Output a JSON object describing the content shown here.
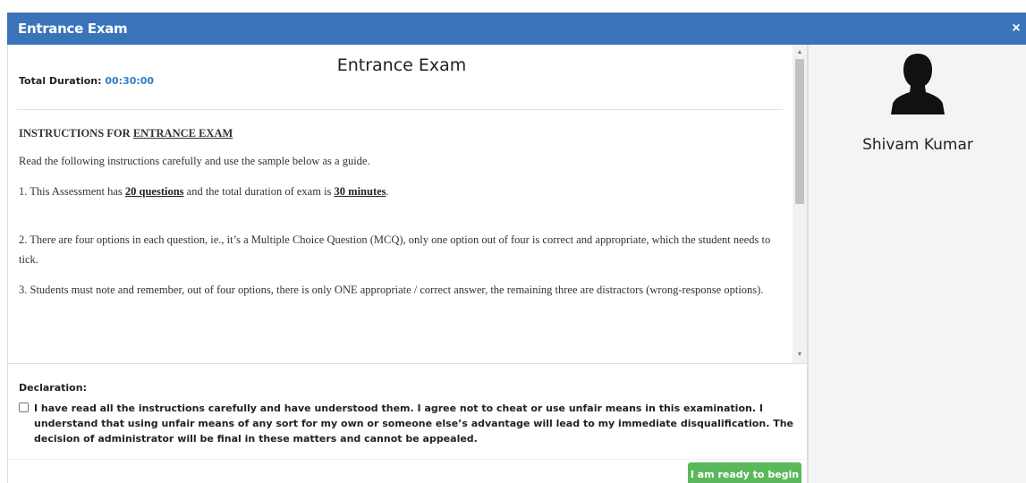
{
  "window": {
    "title": "Entrance Exam",
    "close_glyph": "×",
    "close_icon": "close-icon"
  },
  "exam": {
    "heading": "Entrance Exam",
    "duration_label": "Total Duration:",
    "duration_value": "00:30:00"
  },
  "instructions": {
    "heading_prefix": "INSTRUCTIONS FOR ",
    "heading_underlined": "ENTRANCE EXAM",
    "intro": "Read the following instructions carefully and use the sample below as a guide.",
    "item1": {
      "part1": "1. This Assessment has ",
      "questions": "20 questions",
      "part2": " and the total duration of exam is ",
      "minutes": "30 minutes",
      "part3": "."
    },
    "item2": "2. There are four options in each question, ie., it’s a Multiple Choice Question (MCQ), only one option out of four is correct and appropriate, which the student needs to tick.",
    "item3": "3. Students must note and remember, out of four options, there is only ONE appropriate / correct answer, the remaining three are distractors (wrong-response options)."
  },
  "scrollbar": {
    "up_glyph": "▲",
    "down_glyph": "▼"
  },
  "declaration": {
    "title": "Declaration:",
    "text": "I have read all the instructions carefully and have understood them. I agree not to cheat or use unfair means in this examination. I understand that using unfair means of any sort for my own or someone else’s advantage will lead to my immediate disqualification. The decision of administrator will be final in these matters and cannot be appealed.",
    "checked": false
  },
  "actions": {
    "ready_label": "I am ready to begin"
  },
  "user": {
    "name": "Shivam Kumar",
    "avatar_icon": "user-silhouette-icon"
  },
  "colors": {
    "titlebar": "#3a73ba",
    "accent_link": "#2e7ec8",
    "ready_button": "#5cb85c",
    "side_panel": "#f4f4f4"
  }
}
